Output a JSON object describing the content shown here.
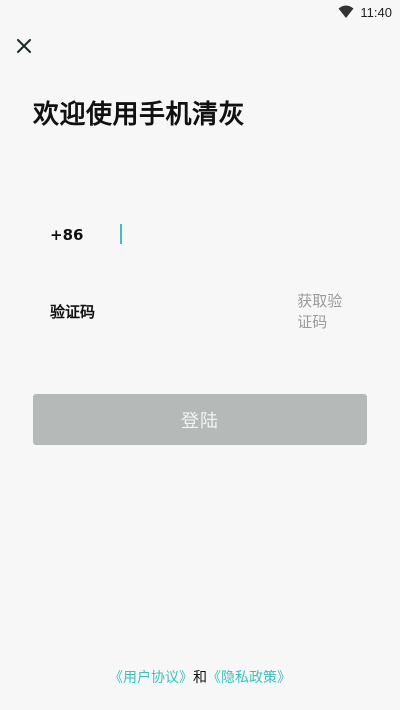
{
  "status_bar": {
    "time": "11:40",
    "wifi_icon": "wifi-icon"
  },
  "header": {
    "close_icon": "close-icon",
    "title": "欢迎使用手机清灰"
  },
  "form": {
    "country_code": "+86",
    "phone_value": "",
    "code_label": "验证码",
    "code_value": "",
    "get_code_label": "获取验证码",
    "login_label": "登陆"
  },
  "footer": {
    "user_agreement": "《用户协议》",
    "and": "和",
    "privacy_policy": "《隐私政策》"
  },
  "colors": {
    "accent": "#3cc0c0",
    "button_disabled": "#b5b9b7",
    "background": "#f7f7f7"
  }
}
